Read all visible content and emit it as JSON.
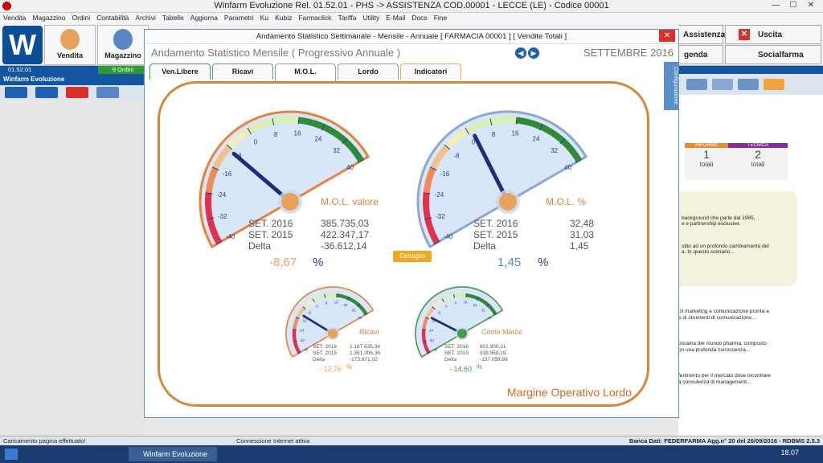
{
  "window": {
    "title": "Winfarm Evoluzione Rel. 01.52.01 - PHS -> ASSISTENZA COD.00001 - LECCE (LE) - Codice 00001"
  },
  "menu": [
    "Vendita",
    "Magazzino",
    "Ordini",
    "Contabilità",
    "Archivi",
    "Tabelle",
    "Aggiorna",
    "Parametri",
    "Ku",
    "Kubiz",
    "Farmaclick",
    "Tariffa",
    "Utility",
    "E-Mail",
    "Docs",
    "Fine"
  ],
  "toolbar": {
    "vendita": "Vendita",
    "magazzino": "Magazzino",
    "assistenza": "Assistenza",
    "uscita": "Uscita",
    "agenda": "genda",
    "socialfarma": "Socialfarma",
    "version": "01.52.01",
    "ordini": "9 Ordini"
  },
  "left": {
    "title": "Winfarm Evoluzione"
  },
  "modal": {
    "title": "Andamento Statistico Settimanale - Mensile - Annuale [ FARMACIA 00001 ] [ Vendite Totali ]",
    "heading": "Andamento Statistico Mensile  ( Progressivo Annuale )",
    "month": "SETTEMBRE 2016",
    "side_tab": "Configurazione",
    "tabs": [
      "Ven.Libere",
      "Ricavi",
      "M.O.L.",
      "Lordo",
      "Indicatori"
    ],
    "footer": "Margine Operativo Lordo",
    "dettaglio": "Dettaglio"
  },
  "gauges": {
    "mol_val": {
      "label": "M.O.L. valore",
      "r1": "SET. 2016",
      "v1": "385.735,03",
      "r2": "SET. 2015",
      "v2": "422.347,17",
      "r3": "Delta",
      "v3": "-36.612,14",
      "pct": "-8,67",
      "unit": "%",
      "needle": -8.67
    },
    "mol_pct": {
      "label": "M.O.L. %",
      "r1": "SET. 2016",
      "v1": "32,48",
      "r2": "SET. 2015",
      "v2": "31,03",
      "r3": "Delta",
      "v3": "1,45",
      "pct": "1,45",
      "unit": "%",
      "needle": 1.45
    },
    "ricavi": {
      "label": "Ricavi",
      "r1": "SET. 2016",
      "v1": "1.187.635,34",
      "r2": "SET. 2015",
      "v2": "1.361.306,36",
      "r3": "Delta",
      "v3": "-173.671,02",
      "pct": "- 12,76",
      "unit": "%",
      "needle": -12.76
    },
    "costo": {
      "label": "Costo Merce",
      "r1": "SET. 2016",
      "v1": "801.900,31",
      "r2": "SET. 2015",
      "v2": "938.959,19",
      "r3": "Delta",
      "v3": "-137.058,88",
      "pct": "- 14,60",
      "unit": "%",
      "needle": -14.6
    }
  },
  "ticks": [
    "-40",
    "-32",
    "-24",
    "-16",
    "-8",
    "0",
    "8",
    "16",
    "24",
    "32",
    "40"
  ],
  "right": {
    "informa": "INFORMA",
    "tecnica": "TECNICA",
    "n1": "1",
    "n2": "2",
    "totali": "totali",
    "texts": [
      "background che parte dal 1985,",
      "e e partnership esclusive.",
      "stito ad un profondo cambiamento del",
      "a. In questo scenario...",
      "izi marketing e comunicazione pronta a",
      "e di strumenti di comunicazione...",
      "porama del mondo pharma, composto",
      "on una profonda conoscenza...",
      "ferimento per il mercato dove incontrare",
      "a consulenza di management..."
    ]
  },
  "status": {
    "left": "Caricamento pagina effettuato!",
    "mid": "Connessione Internet attiva",
    "right": "Banca Dati: FEDERFARMA Agg.n° 20 del 26/09/2016 - RDBMS 2.5.3"
  },
  "taskbar": {
    "app": "Winfarm Evoluzione",
    "time": "18.07"
  }
}
